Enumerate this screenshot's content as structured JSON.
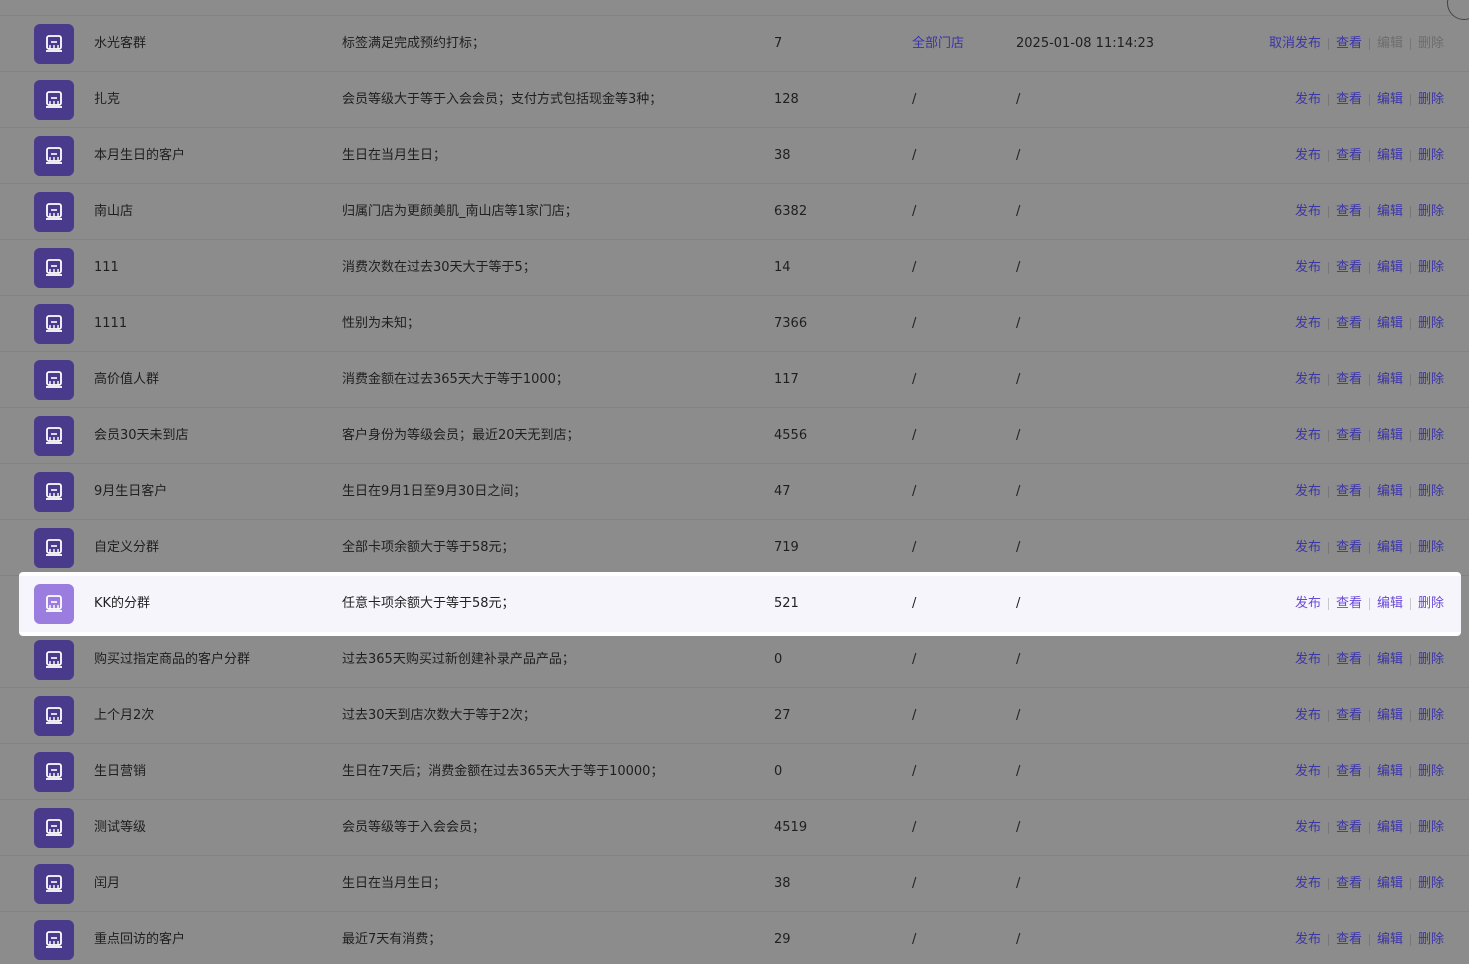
{
  "actions": {
    "publish": "发布",
    "unpublish": "取消发布",
    "view": "查看",
    "edit": "编辑",
    "delete": "删除"
  },
  "rows": [
    {
      "name": "水光客群",
      "condition": "标签满足完成预约打标；",
      "count": "7",
      "store": "全部门店",
      "time": "2025-01-08 11:14:23",
      "published": true
    },
    {
      "name": "扎克",
      "condition": "会员等级大于等于入会会员；支付方式包括现金等3种；",
      "count": "128",
      "store": "/",
      "time": "/"
    },
    {
      "name": "本月生日的客户",
      "condition": "生日在当月生日；",
      "count": "38",
      "store": "/",
      "time": "/"
    },
    {
      "name": "南山店",
      "condition": "归属门店为更颜美肌_南山店等1家门店；",
      "count": "6382",
      "store": "/",
      "time": "/"
    },
    {
      "name": "111",
      "condition": "消费次数在过去30天大于等于5；",
      "count": "14",
      "store": "/",
      "time": "/"
    },
    {
      "name": "1111",
      "condition": "性别为未知；",
      "count": "7366",
      "store": "/",
      "time": "/"
    },
    {
      "name": "高价值人群",
      "condition": "消费金额在过去365天大于等于1000；",
      "count": "117",
      "store": "/",
      "time": "/"
    },
    {
      "name": "会员30天未到店",
      "condition": "客户身份为等级会员；最近20天无到店；",
      "count": "4556",
      "store": "/",
      "time": "/"
    },
    {
      "name": "9月生日客户",
      "condition": "生日在9月1日至9月30日之间；",
      "count": "47",
      "store": "/",
      "time": "/"
    },
    {
      "name": "自定义分群",
      "condition": "全部卡项余额大于等于58元；",
      "count": "719",
      "store": "/",
      "time": "/"
    },
    {
      "name": "KK的分群",
      "condition": "任意卡项余额大于等于58元；",
      "count": "521",
      "store": "/",
      "time": "/",
      "highlight": true
    },
    {
      "name": "购买过指定商品的客户分群",
      "condition": "过去365天购买过新创建补录产品产品；",
      "count": "0",
      "store": "/",
      "time": "/"
    },
    {
      "name": "上个月2次",
      "condition": "过去30天到店次数大于等于2次；",
      "count": "27",
      "store": "/",
      "time": "/"
    },
    {
      "name": "生日营销",
      "condition": "生日在7天后；消费金额在过去365天大于等于10000；",
      "count": "0",
      "store": "/",
      "time": "/"
    },
    {
      "name": "测试等级",
      "condition": "会员等级等于入会会员；",
      "count": "4519",
      "store": "/",
      "time": "/"
    },
    {
      "name": "闰月",
      "condition": "生日在当月生日；",
      "count": "38",
      "store": "/",
      "time": "/"
    },
    {
      "name": "重点回访的客户",
      "condition": "最近7天有消费；",
      "count": "29",
      "store": "/",
      "time": "/"
    }
  ],
  "colors": {
    "accent": "#6a49d9",
    "overlay": "#8c8c8c",
    "icon_bg": "#4a3a8c"
  },
  "icons": {
    "row": "group-card-icon"
  }
}
